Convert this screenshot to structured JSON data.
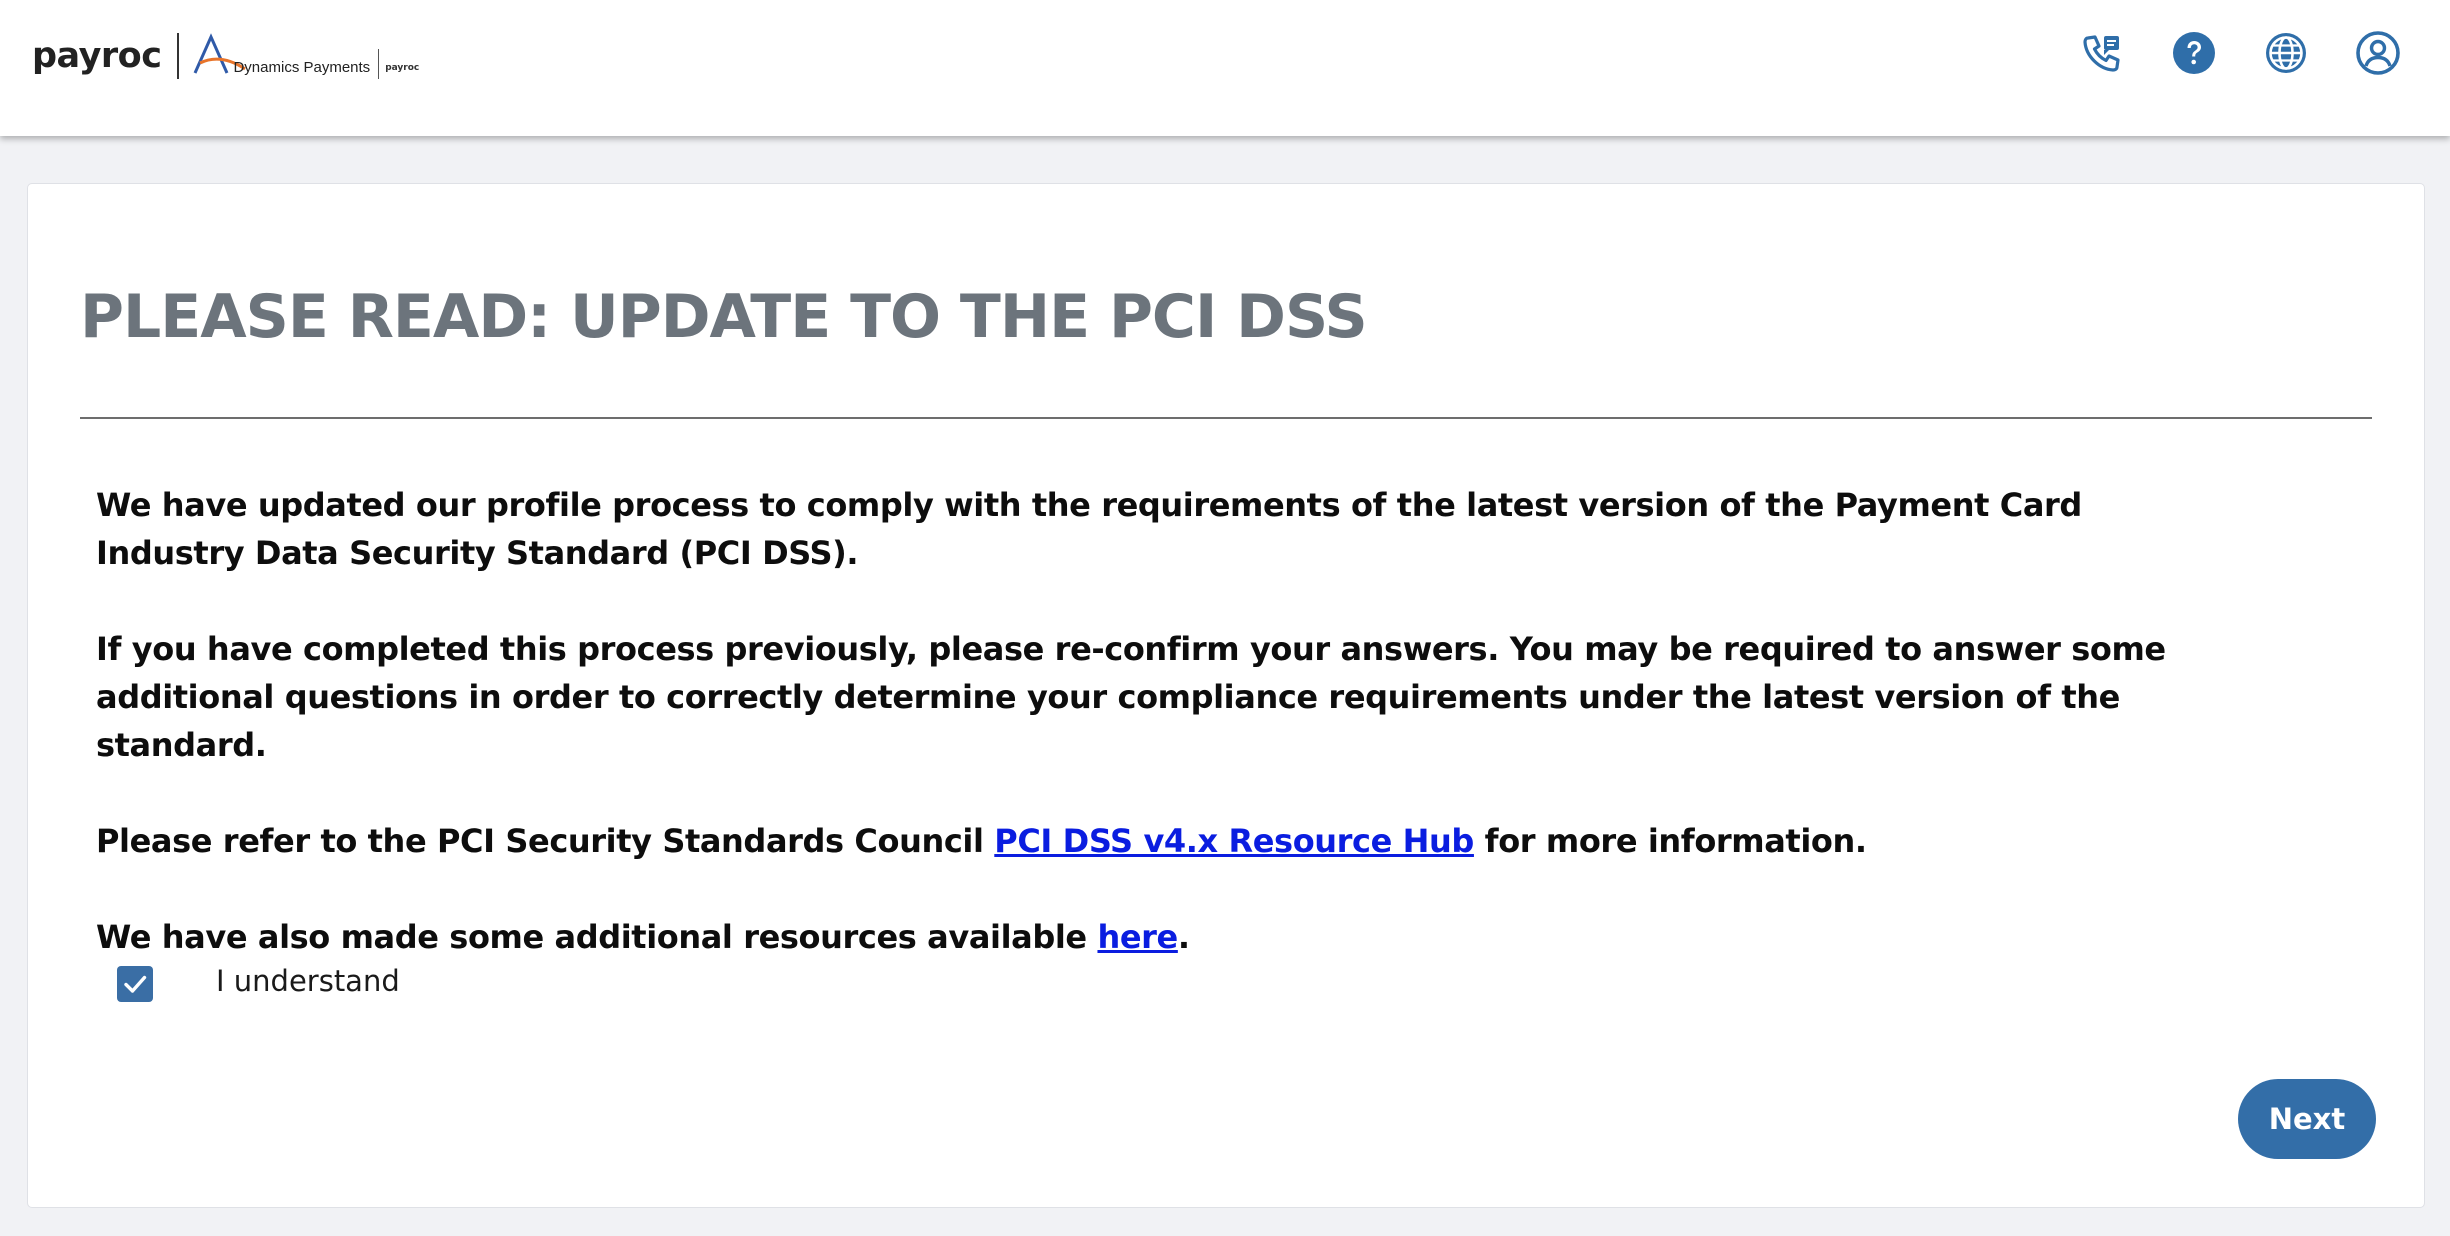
{
  "header": {
    "brand": "payroc",
    "partner_logo": {
      "name": "Dynamics Payments",
      "small_brand": "payroc"
    },
    "icons": [
      "phone-icon",
      "help-icon",
      "globe-icon",
      "user-account-icon"
    ]
  },
  "notice": {
    "title": "PLEASE READ: UPDATE TO THE PCI DSS",
    "para1": "We have updated our profile process to comply with the requirements of the latest version of the Payment Card Industry Data Security Standard (PCI DSS).",
    "para2": "If you have completed this process previously, please re-confirm your answers. You may be required to answer some additional questions in order to correctly determine your compliance requirements under the latest version of the standard.",
    "para3_before": "Please refer to the PCI Security Standards Council ",
    "para3_link": "PCI DSS v4.x Resource Hub",
    "para3_after": " for more information.",
    "para4_before": "We have also made some additional resources available ",
    "para4_link": "here",
    "para4_after": ".",
    "checkbox_label": "I understand",
    "checkbox_checked": true
  },
  "actions": {
    "next_label": "Next"
  },
  "colors": {
    "accent": "#336ea8",
    "title": "#6c747c",
    "link": "#0a1de0",
    "background": "#f1f2f5"
  }
}
